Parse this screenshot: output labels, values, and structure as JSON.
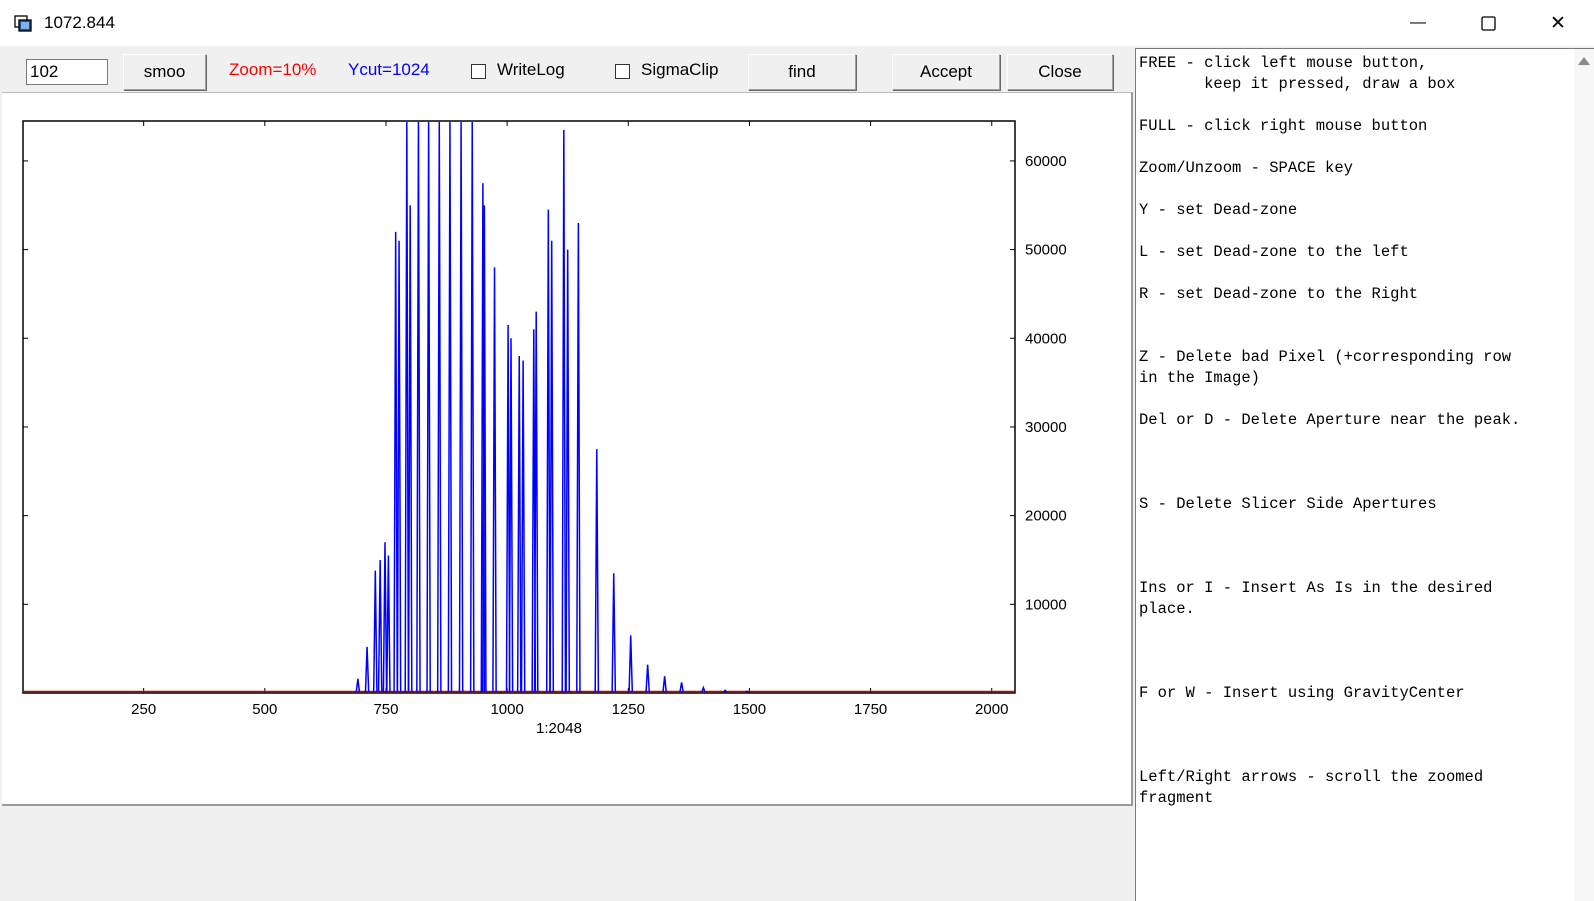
{
  "window": {
    "title": "1072.844",
    "minimize_glyph": "—",
    "close_glyph": "✕"
  },
  "toolbar": {
    "value_input": "102",
    "smoo_label": "smoo",
    "zoom_label": "Zoom=10%",
    "ycut_label": "Ycut=1024",
    "writelog_label": "WriteLog",
    "writelog_checked": false,
    "sigmaclip_label": "SigmaClip",
    "sigmaclip_checked": false,
    "find_label": "find",
    "accept_label": "Accept",
    "close_label": "Close"
  },
  "colors": {
    "zoom_text": "#ff0000",
    "ycut_text": "#0000ff",
    "series_line": "#0000ff",
    "baseline": "#cc0000"
  },
  "chart_data": {
    "type": "line",
    "xlabel": "1:2048",
    "xlim": [
      1,
      2048
    ],
    "ylim": [
      0,
      64500
    ],
    "x_ticks": [
      250,
      500,
      750,
      1000,
      1250,
      1500,
      1750,
      2000
    ],
    "y_ticks": [
      10000,
      20000,
      30000,
      40000,
      50000,
      60000
    ],
    "y_axis_side": "right",
    "peaks": [
      {
        "x": 692,
        "y": 1600
      },
      {
        "x": 711,
        "y": 5200
      },
      {
        "x": 728,
        "y": 13800
      },
      {
        "x": 738,
        "y": 15000
      },
      {
        "x": 748,
        "y": 17000
      },
      {
        "x": 755,
        "y": 15500
      },
      {
        "x": 770,
        "y": 52000
      },
      {
        "x": 777,
        "y": 51000
      },
      {
        "x": 793,
        "y": 64500
      },
      {
        "x": 800,
        "y": 55000
      },
      {
        "x": 817,
        "y": 64500
      },
      {
        "x": 838,
        "y": 64500
      },
      {
        "x": 860,
        "y": 64500
      },
      {
        "x": 882,
        "y": 64500
      },
      {
        "x": 905,
        "y": 64500
      },
      {
        "x": 928,
        "y": 64500
      },
      {
        "x": 950,
        "y": 57500
      },
      {
        "x": 953,
        "y": 55000
      },
      {
        "x": 974,
        "y": 48000
      },
      {
        "x": 1002,
        "y": 41500
      },
      {
        "x": 1008,
        "y": 40000
      },
      {
        "x": 1025,
        "y": 38000
      },
      {
        "x": 1033,
        "y": 37500
      },
      {
        "x": 1055,
        "y": 41000
      },
      {
        "x": 1060,
        "y": 43000
      },
      {
        "x": 1085,
        "y": 54500
      },
      {
        "x": 1092,
        "y": 51000
      },
      {
        "x": 1117,
        "y": 63500
      },
      {
        "x": 1125,
        "y": 50000
      },
      {
        "x": 1147,
        "y": 53000
      },
      {
        "x": 1185,
        "y": 27500
      },
      {
        "x": 1220,
        "y": 13500
      },
      {
        "x": 1255,
        "y": 6500
      },
      {
        "x": 1290,
        "y": 3200
      },
      {
        "x": 1325,
        "y": 1900
      },
      {
        "x": 1360,
        "y": 1200
      },
      {
        "x": 1405,
        "y": 600
      },
      {
        "x": 1450,
        "y": 300
      },
      {
        "x": 1495,
        "y": 200
      }
    ]
  },
  "help": {
    "text": "FREE - click left mouse button,\n       keep it pressed, draw a box\n\nFULL - click right mouse button\n\nZoom/Unzoom - SPACE key\n\nY - set Dead-zone\n\nL - set Dead-zone to the left\n\nR - set Dead-zone to the Right\n\n\nZ - Delete bad Pixel (+corresponding row\nin the Image)\n\nDel or D - Delete Aperture near the peak.\n\n\n\nS - Delete Slicer Side Apertures\n\n\n\nIns or I - Insert As Is in the desired\nplace.\n\n\n\nF or W - Insert using GravityCenter\n\n\n\nLeft/Right arrows - scroll the zoomed\nfragment"
  }
}
